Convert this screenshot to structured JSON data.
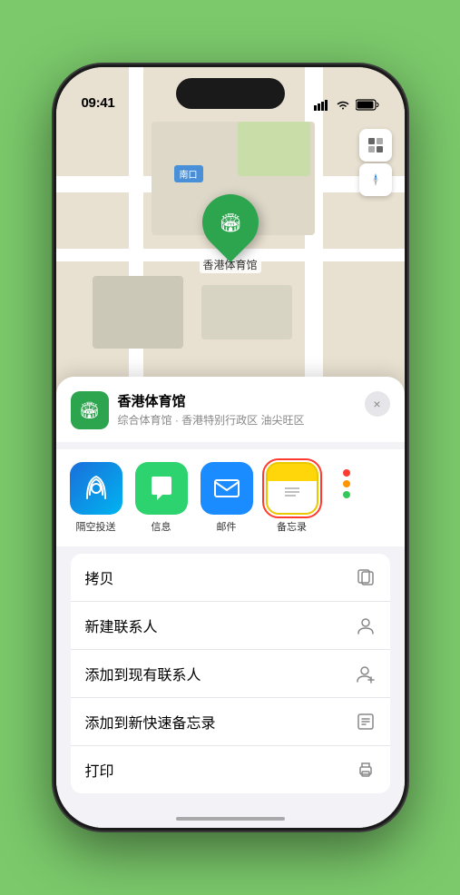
{
  "status_bar": {
    "time": "09:41",
    "signal_bars": "▌▌▌",
    "wifi": "wifi",
    "battery": "battery"
  },
  "map": {
    "label": "南口",
    "venue_pin_label": "香港体育馆"
  },
  "location_header": {
    "venue_name": "香港体育馆",
    "venue_desc": "综合体育馆 · 香港特别行政区 油尖旺区",
    "close_label": "×"
  },
  "share_apps": [
    {
      "id": "airdrop",
      "label": "隔空投送",
      "type": "airdrop"
    },
    {
      "id": "messages",
      "label": "信息",
      "type": "messages"
    },
    {
      "id": "mail",
      "label": "邮件",
      "type": "mail"
    },
    {
      "id": "notes",
      "label": "备忘录",
      "type": "notes",
      "selected": true
    }
  ],
  "more_dots": {
    "colors": [
      "#ff3b30",
      "#ff9500",
      "#34c759"
    ]
  },
  "actions": [
    {
      "id": "copy",
      "label": "拷贝",
      "icon": "copy"
    },
    {
      "id": "new-contact",
      "label": "新建联系人",
      "icon": "person"
    },
    {
      "id": "add-existing",
      "label": "添加到现有联系人",
      "icon": "person-add"
    },
    {
      "id": "add-note",
      "label": "添加到新快速备忘录",
      "icon": "note"
    },
    {
      "id": "print",
      "label": "打印",
      "icon": "print"
    }
  ]
}
